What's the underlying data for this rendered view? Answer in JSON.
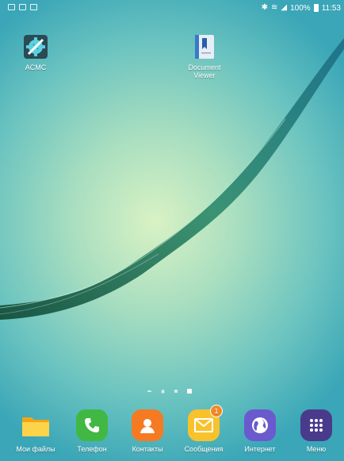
{
  "status_bar": {
    "notification_icons": [
      "message-icon",
      "mail-icon",
      "gallery-icon"
    ],
    "battery": "100%",
    "time": "11:53"
  },
  "desktop": {
    "apps": [
      {
        "label": "ACMC",
        "icon": "gear-wrench-icon"
      },
      {
        "label": "Document\nViewer",
        "icon": "document-viewer-icon"
      }
    ]
  },
  "page_indicator": {
    "pages": 4,
    "active": 4
  },
  "dock": {
    "apps": [
      {
        "label": "Мои файлы",
        "icon": "folder-icon",
        "color": "#f8b61c"
      },
      {
        "label": "Телефон",
        "icon": "phone-icon",
        "color": "#41b843"
      },
      {
        "label": "Контакты",
        "icon": "contacts-icon",
        "color": "#f57a22"
      },
      {
        "label": "Сообщения",
        "icon": "messages-icon",
        "color": "#f8c22c",
        "badge": "1"
      },
      {
        "label": "Интернет",
        "icon": "internet-icon",
        "color": "#6a5acd"
      },
      {
        "label": "Меню",
        "icon": "apps-menu-icon",
        "color": "#4a3a8c"
      }
    ]
  }
}
